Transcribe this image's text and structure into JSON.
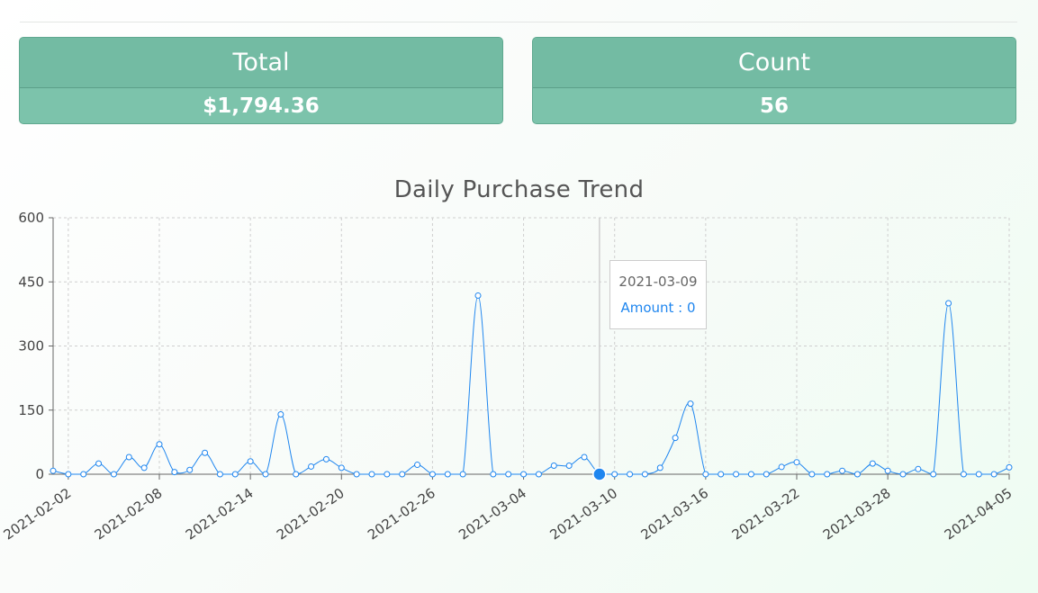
{
  "summary": {
    "total_label": "Total",
    "total_value": "$1,794.36",
    "count_label": "Count",
    "count_value": "56"
  },
  "tooltip": {
    "date": "2021-03-09",
    "value_text": "Amount : 0"
  },
  "colors": {
    "line": "#1f86ef",
    "card": "#78c0a8",
    "grid": "#cfcfcf"
  },
  "chart_data": {
    "type": "line",
    "title": "Daily Purchase Trend",
    "xlabel": "",
    "ylabel": "",
    "ylim": [
      0,
      600
    ],
    "yticks": [
      0,
      150,
      300,
      450,
      600
    ],
    "xticks": [
      "2021-02-02",
      "2021-02-08",
      "2021-02-14",
      "2021-02-20",
      "2021-02-26",
      "2021-03-04",
      "2021-03-10",
      "2021-03-16",
      "2021-03-22",
      "2021-03-28",
      "2021-04-05"
    ],
    "grid": true,
    "highlighted_date": "2021-03-09",
    "series": [
      {
        "name": "Amount",
        "x": [
          "2021-02-01",
          "2021-02-02",
          "2021-02-03",
          "2021-02-04",
          "2021-02-05",
          "2021-02-06",
          "2021-02-07",
          "2021-02-08",
          "2021-02-09",
          "2021-02-10",
          "2021-02-11",
          "2021-02-12",
          "2021-02-13",
          "2021-02-14",
          "2021-02-15",
          "2021-02-16",
          "2021-02-17",
          "2021-02-18",
          "2021-02-19",
          "2021-02-20",
          "2021-02-21",
          "2021-02-22",
          "2021-02-23",
          "2021-02-24",
          "2021-02-25",
          "2021-02-26",
          "2021-02-27",
          "2021-02-28",
          "2021-03-01",
          "2021-03-02",
          "2021-03-03",
          "2021-03-04",
          "2021-03-05",
          "2021-03-06",
          "2021-03-07",
          "2021-03-08",
          "2021-03-09",
          "2021-03-10",
          "2021-03-11",
          "2021-03-12",
          "2021-03-13",
          "2021-03-14",
          "2021-03-15",
          "2021-03-16",
          "2021-03-17",
          "2021-03-18",
          "2021-03-19",
          "2021-03-20",
          "2021-03-21",
          "2021-03-22",
          "2021-03-23",
          "2021-03-24",
          "2021-03-25",
          "2021-03-26",
          "2021-03-27",
          "2021-03-28",
          "2021-03-29",
          "2021-03-30",
          "2021-03-31",
          "2021-04-01",
          "2021-04-02",
          "2021-04-03",
          "2021-04-04",
          "2021-04-05"
        ],
        "values": [
          8,
          0,
          0,
          25,
          0,
          40,
          15,
          70,
          5,
          10,
          50,
          0,
          0,
          30,
          0,
          140,
          0,
          18,
          35,
          15,
          0,
          0,
          0,
          0,
          22,
          0,
          0,
          0,
          418,
          0,
          0,
          0,
          0,
          20,
          20,
          40,
          0,
          0,
          0,
          0,
          15,
          85,
          165,
          0,
          0,
          0,
          0,
          0,
          17,
          28,
          0,
          0,
          8,
          0,
          25,
          8,
          0,
          12,
          0,
          400,
          0,
          0,
          0,
          16
        ]
      }
    ]
  }
}
